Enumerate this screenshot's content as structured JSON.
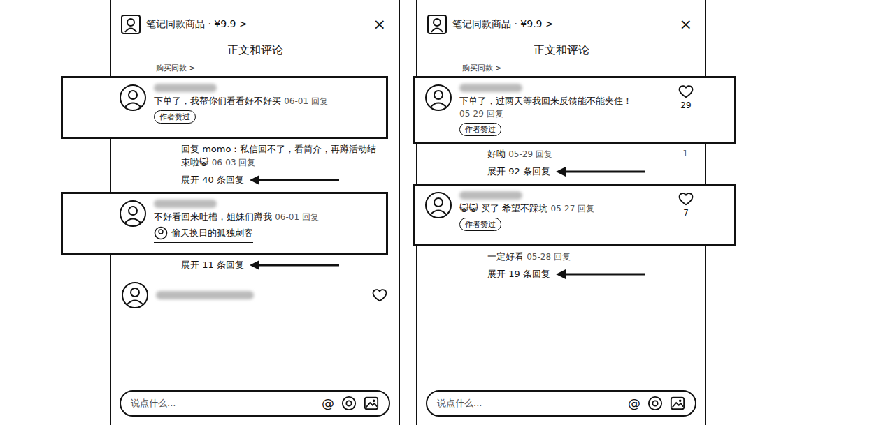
{
  "panels": [
    {
      "header": {
        "title": "笔记同款商品 · ¥9.9 >",
        "close": "×"
      },
      "section_title": "正文和评论",
      "buy_link": "购买同款 >",
      "comments": [
        {
          "kind": "full",
          "highlighted": true,
          "text": "下单了，我帮你们看看好不好买",
          "date": "06-01",
          "action": "回复",
          "tag": "作者赞过",
          "replies": [
            {
              "text": "回复 momo：私信回不了，看简介，再蹲活动结束啦😺",
              "date": "06-03",
              "action": "回复"
            }
          ],
          "expand": {
            "label": "展开 40 条回复",
            "marked": true
          }
        },
        {
          "kind": "full",
          "highlighted": true,
          "text": "不好看回来吐槽，姐妹们蹲我",
          "date": "06-01",
          "action": "回复",
          "reply_author": "偷天换日的孤独刺客",
          "replies": [],
          "expand": {
            "label": "展开 11 条回复",
            "marked": true
          }
        },
        {
          "kind": "cut",
          "highlighted": false
        }
      ],
      "input": {
        "placeholder": "说点什么...",
        "at": "@"
      }
    },
    {
      "header": {
        "title": "笔记同款商品 · ¥9.9 >",
        "close": "×"
      },
      "section_title": "正文和评论",
      "buy_link": "购买同款 >",
      "comments": [
        {
          "kind": "full",
          "highlighted": true,
          "text": "下单了，过两天等我回来反馈能不能夹住！",
          "date": "05-29",
          "action": "回复",
          "likes": "29",
          "tag": "作者赞过",
          "replies": [
            {
              "text": "好呦",
              "date": "05-29",
              "action": "回复",
              "likes": "1"
            }
          ],
          "expand": {
            "label": "展开 92 条回复",
            "marked": true
          }
        },
        {
          "kind": "full",
          "highlighted": true,
          "text": "😺😺 买了 希望不踩坑",
          "date": "05-27",
          "action": "回复",
          "likes": "7",
          "tag": "作者赞过",
          "replies": [
            {
              "text": "一定好看",
              "date": "05-28",
              "action": "回复"
            }
          ],
          "expand": {
            "label": "展开 19 条回复",
            "marked": true
          }
        }
      ],
      "input": {
        "placeholder": "说点什么...",
        "at": "@"
      }
    }
  ]
}
